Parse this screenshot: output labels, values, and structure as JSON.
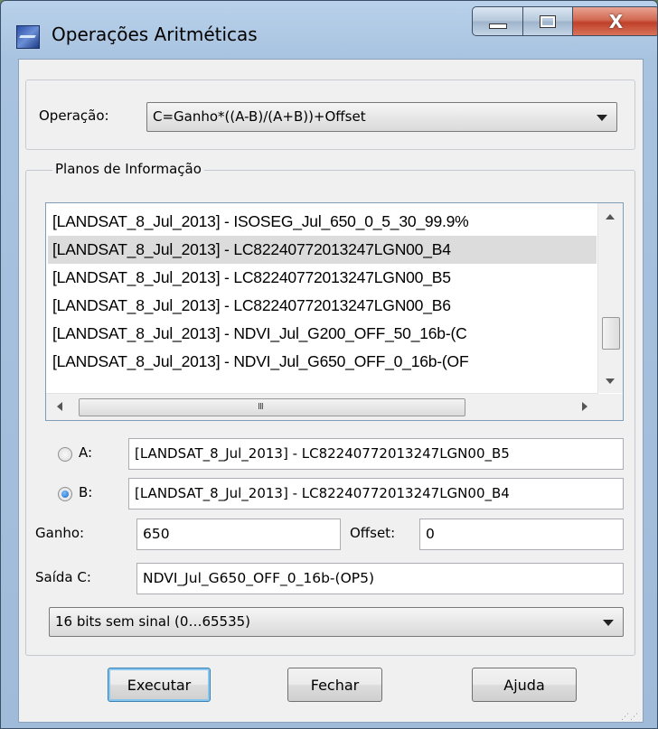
{
  "window": {
    "title": "Operações Aritméticas",
    "close_glyph": "X"
  },
  "operation": {
    "label": "Operação:",
    "selected": "C=Ganho*((A-B)/(A+B))+Offset"
  },
  "planes": {
    "group_title": "Planos de Informação",
    "items": [
      "[LANDSAT_8_Jul_2013] - ISOSEG_Jul_650_0_5_30_99.9%",
      "[LANDSAT_8_Jul_2013] - LC82240772013247LGN00_B4",
      "[LANDSAT_8_Jul_2013] - LC82240772013247LGN00_B5",
      "[LANDSAT_8_Jul_2013] - LC82240772013247LGN00_B6",
      "[LANDSAT_8_Jul_2013] - NDVI_Jul_G200_OFF_50_16b-(C",
      "[LANDSAT_8_Jul_2013] - NDVI_Jul_G650_OFF_0_16b-(OF"
    ],
    "selected_index": 1,
    "hscroll_grip": "III"
  },
  "a_field": {
    "label": "A:",
    "value": "[LANDSAT_8_Jul_2013] - LC82240772013247LGN00_B5",
    "checked": false
  },
  "b_field": {
    "label": "B:",
    "value": "[LANDSAT_8_Jul_2013] - LC82240772013247LGN00_B4",
    "checked": true
  },
  "gain": {
    "label": "Ganho:",
    "value": "650"
  },
  "offset": {
    "label": "Offset:",
    "value": "0"
  },
  "output": {
    "label": "Saída C:",
    "value": "NDVI_Jul_G650_OFF_0_16b-(OP5)"
  },
  "data_type": {
    "selected": "16 bits sem sinal (0…65535)"
  },
  "buttons": {
    "execute": "Executar",
    "close": "Fechar",
    "help": "Ajuda"
  },
  "colors": {
    "titlebar": "#a8c3e0",
    "close_button": "#c0402a",
    "selection": "#dcdcdc",
    "default_button_focus": "#86c6ef"
  }
}
